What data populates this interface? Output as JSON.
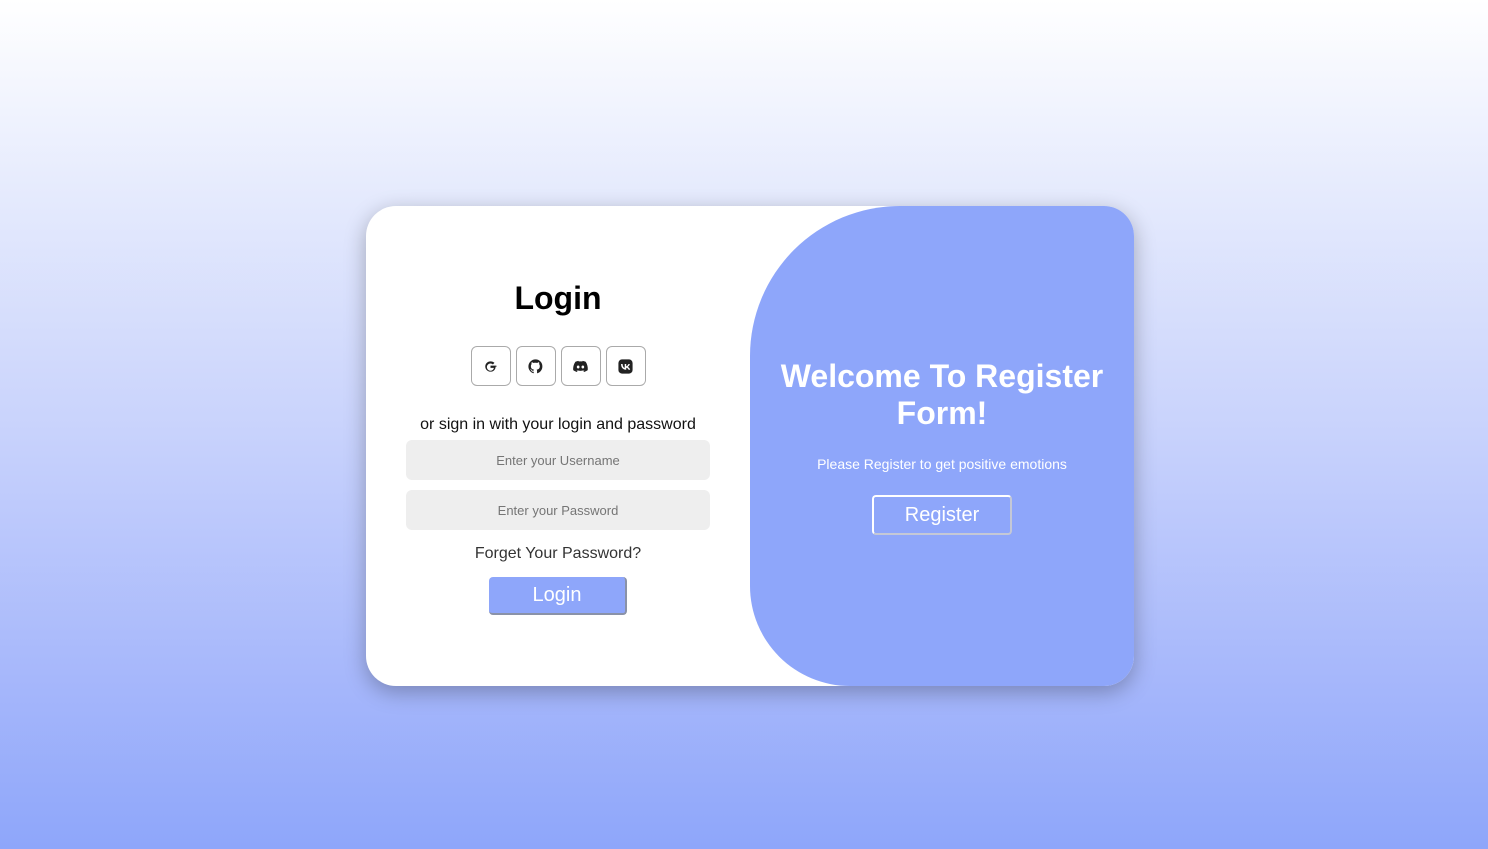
{
  "login": {
    "title": "Login",
    "social_icons": [
      "google-icon",
      "github-icon",
      "discord-icon",
      "vk-icon"
    ],
    "divider_text": "or sign in with your login and password",
    "username_placeholder": "Enter your Username",
    "password_placeholder": "Enter your Password",
    "forgot_link": "Forget Your Password?",
    "submit_label": "Login"
  },
  "register_panel": {
    "title": "Welcome To Register Form!",
    "subtitle": "Please Register to get positive emotions",
    "button_label": "Register"
  },
  "colors": {
    "accent": "#8ea6fa",
    "field_background": "#eeeeee",
    "card_background": "#ffffff"
  }
}
